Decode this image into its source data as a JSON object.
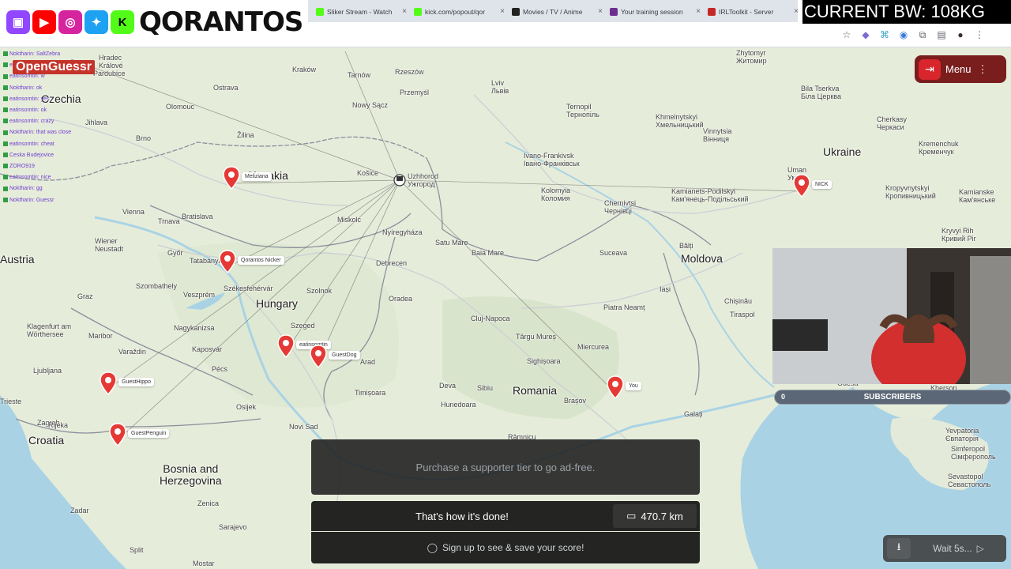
{
  "stream_overlay": {
    "logo_text": "QORANTOS",
    "bandwidth": "CURRENT BW: 108KG",
    "game_logo": "OpenGuessr"
  },
  "browser": {
    "tabs": [
      {
        "title": "Sliker Stream - Watch",
        "favicon_color": "#53fc18"
      },
      {
        "title": "kick.com/popout/qor",
        "favicon_color": "#53fc18"
      },
      {
        "title": "Movies / TV / Anime",
        "favicon_color": "#222222"
      },
      {
        "title": "Your training session",
        "favicon_color": "#6b2f8f"
      },
      {
        "title": "IRLToolkit - Server",
        "favicon_color": "#c62828"
      }
    ],
    "toolbar_icons": [
      "star-icon",
      "extension-icon",
      "extension-icon",
      "extension-icon",
      "puzzle-icon",
      "sidebar-icon",
      "profile-icon",
      "kebab-icon"
    ]
  },
  "chat": {
    "lines": [
      "Noktharin: SaltZebra",
      "eatinsomtin: lol",
      "eatinsomtin: w",
      "Noktharin: ok",
      "eatinsomtin: yes",
      "eatinsomtin: ok",
      "eatinsomtin: crazy",
      "Noktharin: that was close",
      "eatinsomtin: cheat",
      "Ceska Budejovice",
      "ZORO919",
      "eatinsomtin: nice",
      "Noktharin: gg",
      "Noktharin: Guessr"
    ]
  },
  "map": {
    "countries": [
      "Czechia",
      "Slovakia",
      "Ukraine",
      "Moldova",
      "Austria",
      "Hungary",
      "Romania",
      "Croatia",
      "Bosnia and\nHerzegovina"
    ],
    "places": [
      {
        "name": "Hradec\nKrálové"
      },
      {
        "name": "Pardubice"
      },
      {
        "name": "Olomouc"
      },
      {
        "name": "Brno"
      },
      {
        "name": "Jihlava"
      },
      {
        "name": "Ostrava"
      },
      {
        "name": "Kraków"
      },
      {
        "name": "Tarnów"
      },
      {
        "name": "Rzeszów"
      },
      {
        "name": "Przemyśl"
      },
      {
        "name": "Lviv\nЛьвів"
      },
      {
        "name": "Ternopil\nТернопіль"
      },
      {
        "name": "Khmelnytskyi\nХмельницький"
      },
      {
        "name": "Vinnytsia\nВінниця"
      },
      {
        "name": "Zhytomyr\nЖитомир"
      },
      {
        "name": "Bila Tserkva\nБіла Церква"
      },
      {
        "name": "Cherkasy\nЧеркаси"
      },
      {
        "name": "Kremenchuk\nКременчук"
      },
      {
        "name": "Uman\nУмань"
      },
      {
        "name": "Kropyvnytskyi\nКропивницький"
      },
      {
        "name": "Kryvyi Rih\nКривий Ріг"
      },
      {
        "name": "Ivano-Frankivsk\nІвано-Франківськ"
      },
      {
        "name": "Kolomyia\nКоломия"
      },
      {
        "name": "Chernivtsi\nЧернівці"
      },
      {
        "name": "Kamianets-Podilskyi\nКам'янець-Подільський"
      },
      {
        "name": "Nowy Sącz"
      },
      {
        "name": "Žilina"
      },
      {
        "name": "Košice"
      },
      {
        "name": "Uzhhorod\nУжгород"
      },
      {
        "name": "Vienna"
      },
      {
        "name": "Bratislava"
      },
      {
        "name": "Trnava"
      },
      {
        "name": "Wiener\nNeustadt"
      },
      {
        "name": "Győr"
      },
      {
        "name": "Tatabánya"
      },
      {
        "name": "Szombathely"
      },
      {
        "name": "Graz"
      },
      {
        "name": "Klagenfurt am\nWörthersee"
      },
      {
        "name": "Maribor"
      },
      {
        "name": "Ljubljana"
      },
      {
        "name": "Zagreb"
      },
      {
        "name": "Székesfehérvár"
      },
      {
        "name": "Szolnok"
      },
      {
        "name": "Debrecen"
      },
      {
        "name": "Miskolc"
      },
      {
        "name": "Nyíregyháza"
      },
      {
        "name": "Satu Mare"
      },
      {
        "name": "Baia Mare"
      },
      {
        "name": "Suceava"
      },
      {
        "name": "Bălți"
      },
      {
        "name": "Iași"
      },
      {
        "name": "Chișinău"
      },
      {
        "name": "Tiraspol"
      },
      {
        "name": "Oradea"
      },
      {
        "name": "Cluj-Napoca"
      },
      {
        "name": "Târgu Mureș"
      },
      {
        "name": "Piatra Neamț"
      },
      {
        "name": "Sighișoara"
      },
      {
        "name": "Miercurea"
      },
      {
        "name": "Sibiu"
      },
      {
        "name": "Brașov"
      },
      {
        "name": "Deva"
      },
      {
        "name": "Hunedoara"
      },
      {
        "name": "Arad"
      },
      {
        "name": "Timișoara"
      },
      {
        "name": "Szeged"
      },
      {
        "name": "Pécs"
      },
      {
        "name": "Kaposvár"
      },
      {
        "name": "Osijek"
      },
      {
        "name": "Novi Sad"
      },
      {
        "name": "Nagykanizsa"
      },
      {
        "name": "Varaždin"
      },
      {
        "name": "Trieste"
      },
      {
        "name": "Rijeka"
      },
      {
        "name": "Zadar"
      },
      {
        "name": "Split"
      },
      {
        "name": "Zenica"
      },
      {
        "name": "Sarajevo"
      },
      {
        "name": "Mostar"
      },
      {
        "name": "Galați"
      },
      {
        "name": "Râmnicu"
      },
      {
        "name": "Veszprém"
      },
      {
        "name": "Sevastopol\nСевастополь"
      },
      {
        "name": "Simferopol\nСімферополь"
      },
      {
        "name": "Yevpatoria\nЄвпаторія"
      },
      {
        "name": "Kherson\nХерсон"
      },
      {
        "name": "Odesa"
      },
      {
        "name": "Kamianske\nКам'янське"
      }
    ],
    "pins": [
      {
        "label": "Meliziana"
      },
      {
        "label": "Qorantos Nicker"
      },
      {
        "label": "eatinsomtin"
      },
      {
        "label": "GuestDog"
      },
      {
        "label": "GuestHippo"
      },
      {
        "label": "GuestPenguin"
      },
      {
        "label": "NICK"
      },
      {
        "label": "You"
      }
    ]
  },
  "menu": {
    "label": "Menu"
  },
  "subscribers": {
    "count": "0",
    "label": "SUBSCRIBERS"
  },
  "result": {
    "ad_text": "Purchase a supporter tier to go ad-free.",
    "done_text": "That's how it's done!",
    "distance": "470.7 km",
    "signup_text": "Sign up to see & save your score!"
  },
  "controls": {
    "wait_label": "Wait 5s..."
  },
  "colors": {
    "pin": "#e53935",
    "menu_bg": "#7a1d1d",
    "leave": "#d8262c",
    "water": "#a7d3e6",
    "land": "#e4ead9"
  }
}
